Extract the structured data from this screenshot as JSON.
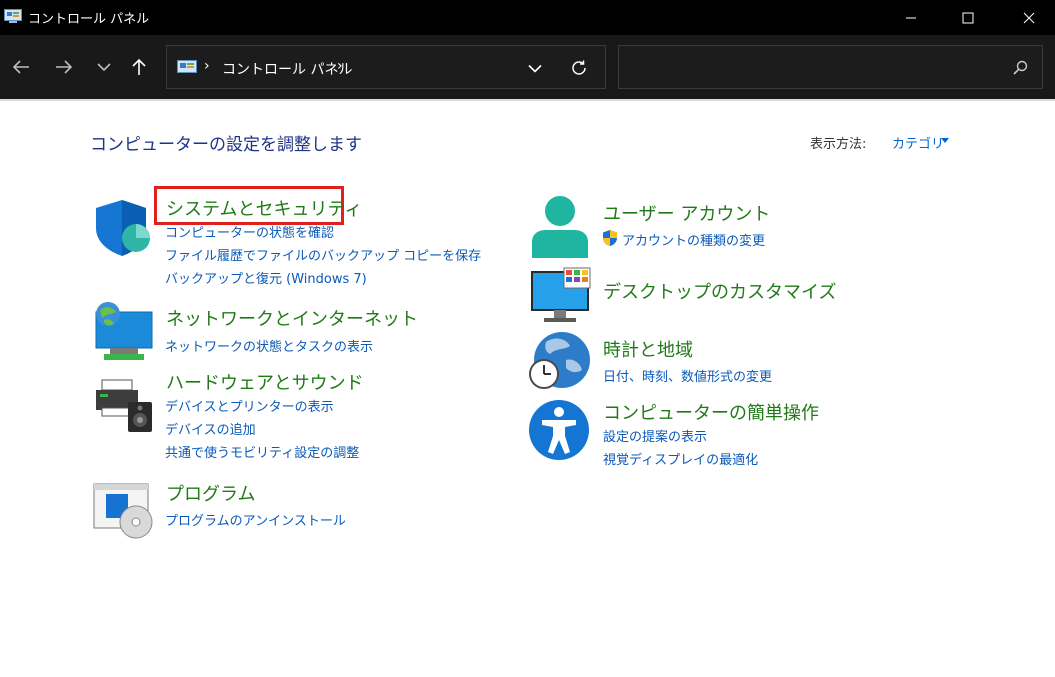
{
  "window": {
    "title": "コントロール パネル"
  },
  "address": {
    "separator": "›",
    "crumb": "コントロール パネル"
  },
  "search": {
    "placeholder": "",
    "value": ""
  },
  "header": {
    "page_title": "コンピューターの設定を調整します",
    "view_by_label": "表示方法:",
    "view_by_value": "カテゴリ"
  },
  "categories": [
    {
      "title": "システムとセキュリティ",
      "icon": "shield-icon",
      "links": [
        "コンピューターの状態を確認",
        "ファイル履歴でファイルのバックアップ コピーを保存",
        "バックアップと復元 (Windows 7)"
      ]
    },
    {
      "title": "ネットワークとインターネット",
      "icon": "network-globe-icon",
      "links": [
        "ネットワークの状態とタスクの表示"
      ]
    },
    {
      "title": "ハードウェアとサウンド",
      "icon": "printer-speaker-icon",
      "links": [
        "デバイスとプリンターの表示",
        "デバイスの追加",
        "共通で使うモビリティ設定の調整"
      ]
    },
    {
      "title": "プログラム",
      "icon": "programs-disc-icon",
      "links": [
        "プログラムのアンインストール"
      ]
    },
    {
      "title": "ユーザー アカウント",
      "icon": "user-icon",
      "links": [
        "アカウントの種類の変更"
      ]
    },
    {
      "title": "デスクトップのカスタマイズ",
      "icon": "monitor-icon",
      "links": []
    },
    {
      "title": "時計と地域",
      "icon": "clock-globe-icon",
      "links": [
        "日付、時刻、数値形式の変更"
      ]
    },
    {
      "title": "コンピューターの簡単操作",
      "icon": "accessibility-icon",
      "links": [
        "設定の提案の表示",
        "視覚ディスプレイの最適化"
      ]
    }
  ],
  "colors": {
    "title_bar": "#000000",
    "toolbar": "#191919",
    "category_title": "#217a18",
    "link": "#0b5ab8",
    "page_title": "#1e3287",
    "highlight": "#e0201c"
  }
}
